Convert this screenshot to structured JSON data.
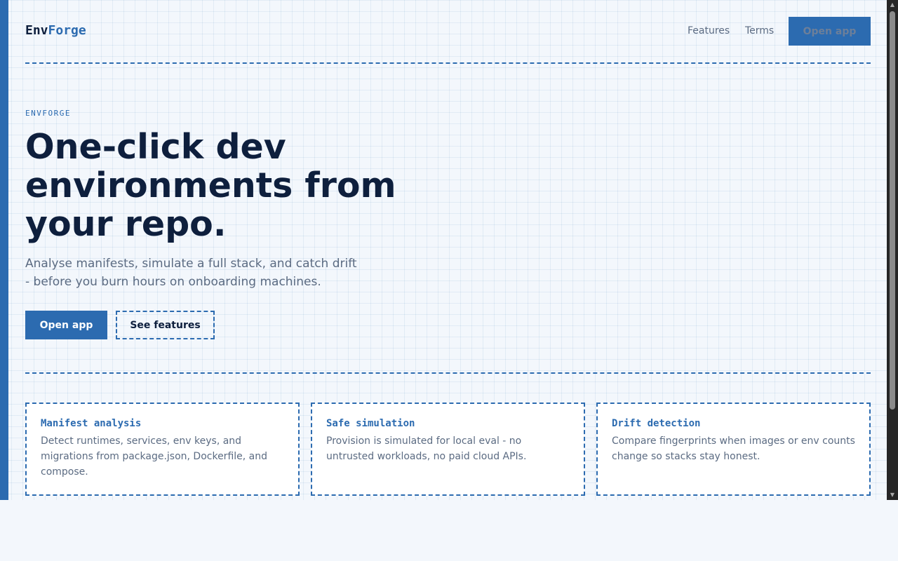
{
  "header": {
    "logo_prefix": "Env",
    "logo_accent": "Forge",
    "nav": [
      {
        "label": "Features"
      },
      {
        "label": "Terms"
      }
    ],
    "cta_label": "Open app"
  },
  "hero": {
    "eyebrow": "ENVFORGE",
    "headline_lines": [
      "One-click dev",
      "environments from",
      "your repo."
    ],
    "subhead_lines": [
      "Analyse manifests, simulate a full stack, and catch drift",
      "- before you burn hours on onboarding machines."
    ],
    "primary_button": "Open app",
    "secondary_button": "See features"
  },
  "features": [
    {
      "title": "Manifest analysis",
      "description": "Detect runtimes, services, env keys, and migrations from package.json, Dockerfile, and compose."
    },
    {
      "title": "Safe simulation",
      "description": "Provision is simulated for local eval - no untrusted workloads, no paid cloud APIs."
    },
    {
      "title": "Drift detection",
      "description": "Compare fingerprints when images or env counts change so stacks stay honest."
    }
  ],
  "colors": {
    "accent": "#2c6bb0",
    "ink": "#0e1f3d",
    "muted": "#5b6b82",
    "background": "#f3f7fc"
  },
  "icons": [
    "scroll-up-arrow-icon",
    "scroll-down-arrow-icon"
  ]
}
